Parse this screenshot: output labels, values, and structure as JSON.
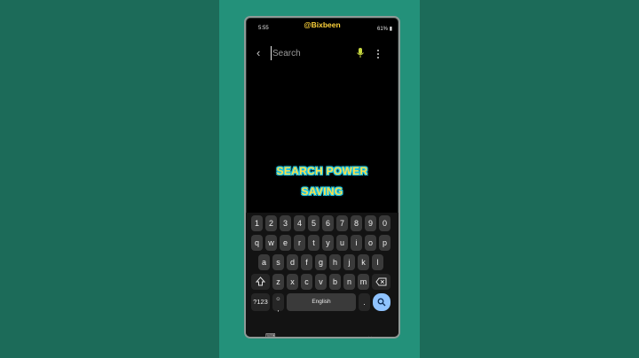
{
  "watermark": "@Bixbeen",
  "status": {
    "time": "5:55",
    "battery": "61%"
  },
  "search": {
    "placeholder": "Search"
  },
  "icons": {
    "back": "back-arrow-icon",
    "mic": "microphone-icon",
    "more": "more-vertical-icon"
  },
  "caption": {
    "line1": "SEARCH POWER",
    "line2": "SAVING"
  },
  "keyboard": {
    "numbers": [
      "1",
      "2",
      "3",
      "4",
      "5",
      "6",
      "7",
      "8",
      "9",
      "0"
    ],
    "row1": [
      "q",
      "w",
      "e",
      "r",
      "t",
      "y",
      "u",
      "i",
      "o",
      "p"
    ],
    "row2": [
      "a",
      "s",
      "d",
      "f",
      "g",
      "h",
      "j",
      "k",
      "l"
    ],
    "row3": [
      "z",
      "x",
      "c",
      "v",
      "b",
      "n",
      "m"
    ],
    "symbols_key": "?123",
    "comma_key": ",",
    "space_label": "English",
    "period_key": ".",
    "shift_icon": "shift-icon",
    "backspace_icon": "backspace-icon",
    "search_icon": "search-icon"
  },
  "colors": {
    "caption_fill": "#ffe14a",
    "caption_outline": "#1ec8e8",
    "accent_key": "#8fc3ff",
    "mic": "#c8d940"
  }
}
